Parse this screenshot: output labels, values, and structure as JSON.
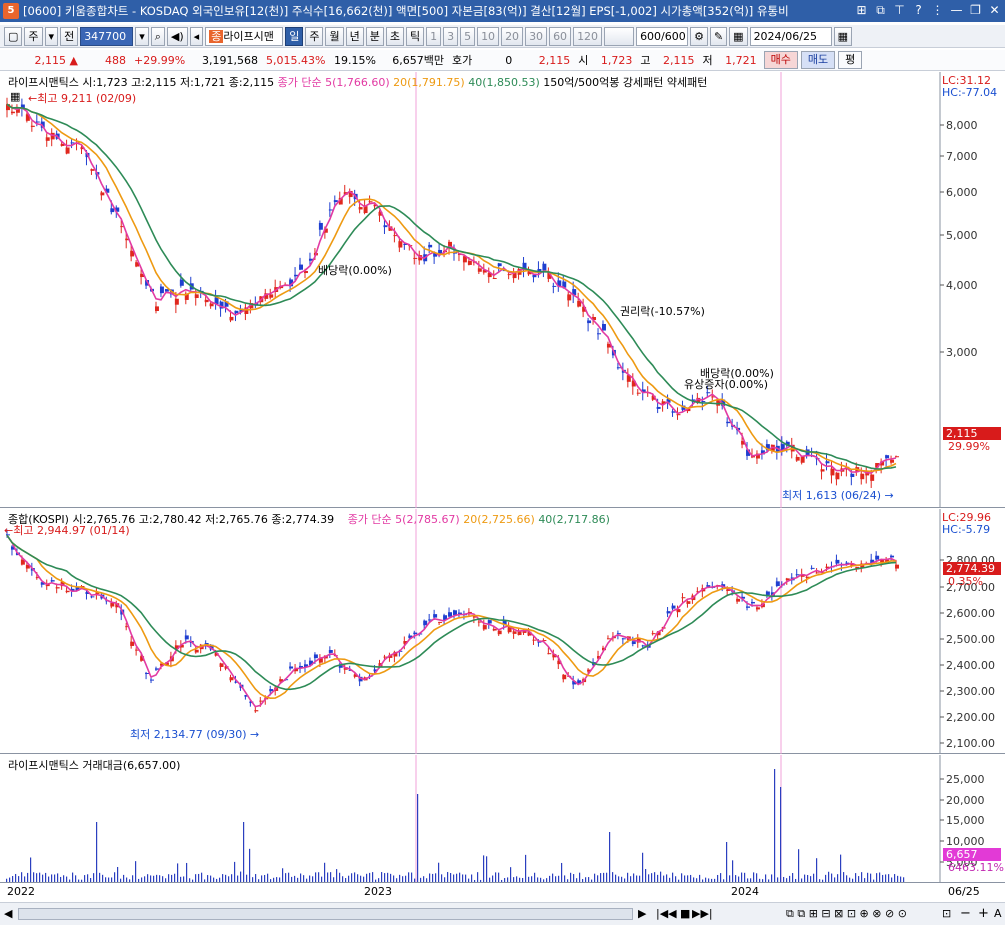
{
  "titlebar": {
    "text": "[0600] 키움종합차트 - KOSDAQ 외국인보유[12(천)] 주식수[16,662(천)] 액면[500] 자본금[83(억)] 결산[12월] EPS[-1,002] 시가총액[352(억)] 유통비"
  },
  "toolbar": {
    "market": "주",
    "all": "전",
    "code": "347700",
    "name": "라이프시맨",
    "periods": [
      "일",
      "주",
      "월",
      "년",
      "분",
      "초",
      "틱"
    ],
    "nums": [
      "1",
      "3",
      "5",
      "10",
      "20",
      "30",
      "60",
      "120"
    ],
    "count": "600/600",
    "date": "2024/06/25",
    "buy": "매수",
    "sell": "매도",
    "flat": "평"
  },
  "quote": {
    "price": "2,115",
    "change": "488",
    "pct": "+29.99%",
    "volume": "3,191,568",
    "vol_ratio": "5,015.43%",
    "turnover": "19.15%",
    "amount": "6,657백만",
    "hoga_label": "호가",
    "hoga_val": "0",
    "hoga_price": "2,115",
    "open_label": "시",
    "open": "1,723",
    "high_label": "고",
    "high": "2,115",
    "low_label": "저",
    "low": "1,721"
  },
  "pane1": {
    "header_name": "라이프시맨틱스 시:1,723 고:2,115 저:1,721 종:2,115",
    "ma_label": "종가 단순 5(1,766.60)",
    "ma20": "20(1,791.75)",
    "ma40": "40(1,850.53)",
    "pattern": "150억/500억봉 강세패턴",
    "pattern2": "약세패턴",
    "lc": "LC:31.12",
    "hc": "HC:-77.04",
    "high_note": "최고 9,211 (02/09)",
    "low_note": "최저 1,613 (06/24)",
    "ann1": "배당락(0.00%)",
    "ann2": "권리락(-10.57%)",
    "ann3": "배당락(0.00%)",
    "ann4": "유상증자(0.00%)",
    "price_tag": "2,115",
    "pct_tag": "29.99%",
    "yaxis": [
      "8,000",
      "7,000",
      "6,000",
      "5,000",
      "4,000",
      "3,000"
    ]
  },
  "pane2": {
    "header_name": "종합(KOSPI) 시:2,765.76 고:2,780.42 저:2,765.76 종:2,774.39",
    "ma_label": "종가 단순 5(2,785.67)",
    "ma20": "20(2,725.66)",
    "ma40": "40(2,717.86)",
    "lc": "LC:29.96",
    "hc": "HC:-5.79",
    "high_note": "최고 2,944.97 (01/14)",
    "low_note": "최저 2,134.77 (09/30)",
    "price_tag": "2,774.39",
    "pct_tag": "0.35%",
    "yaxis": [
      "2,800.00",
      "2,700.00",
      "2,600.00",
      "2,500.00",
      "2,400.00",
      "2,300.00",
      "2,200.00",
      "2,100.00"
    ]
  },
  "pane3": {
    "header_name": "라이프시맨틱스 거래대금(6,657.00)",
    "value_tag": "6,657",
    "pct_tag": "6463.11%",
    "yaxis": [
      "25,000",
      "20,000",
      "15,000",
      "10,000",
      "5,000"
    ]
  },
  "xaxis": {
    "labels": [
      "2022",
      "2023",
      "2024"
    ],
    "last": "06/25"
  },
  "colors": {
    "ma5": "#e23aa3",
    "ma20": "#ee9a12",
    "ma40": "#2e8b57",
    "up": "#e0281e",
    "down": "#1f3fd0"
  }
}
